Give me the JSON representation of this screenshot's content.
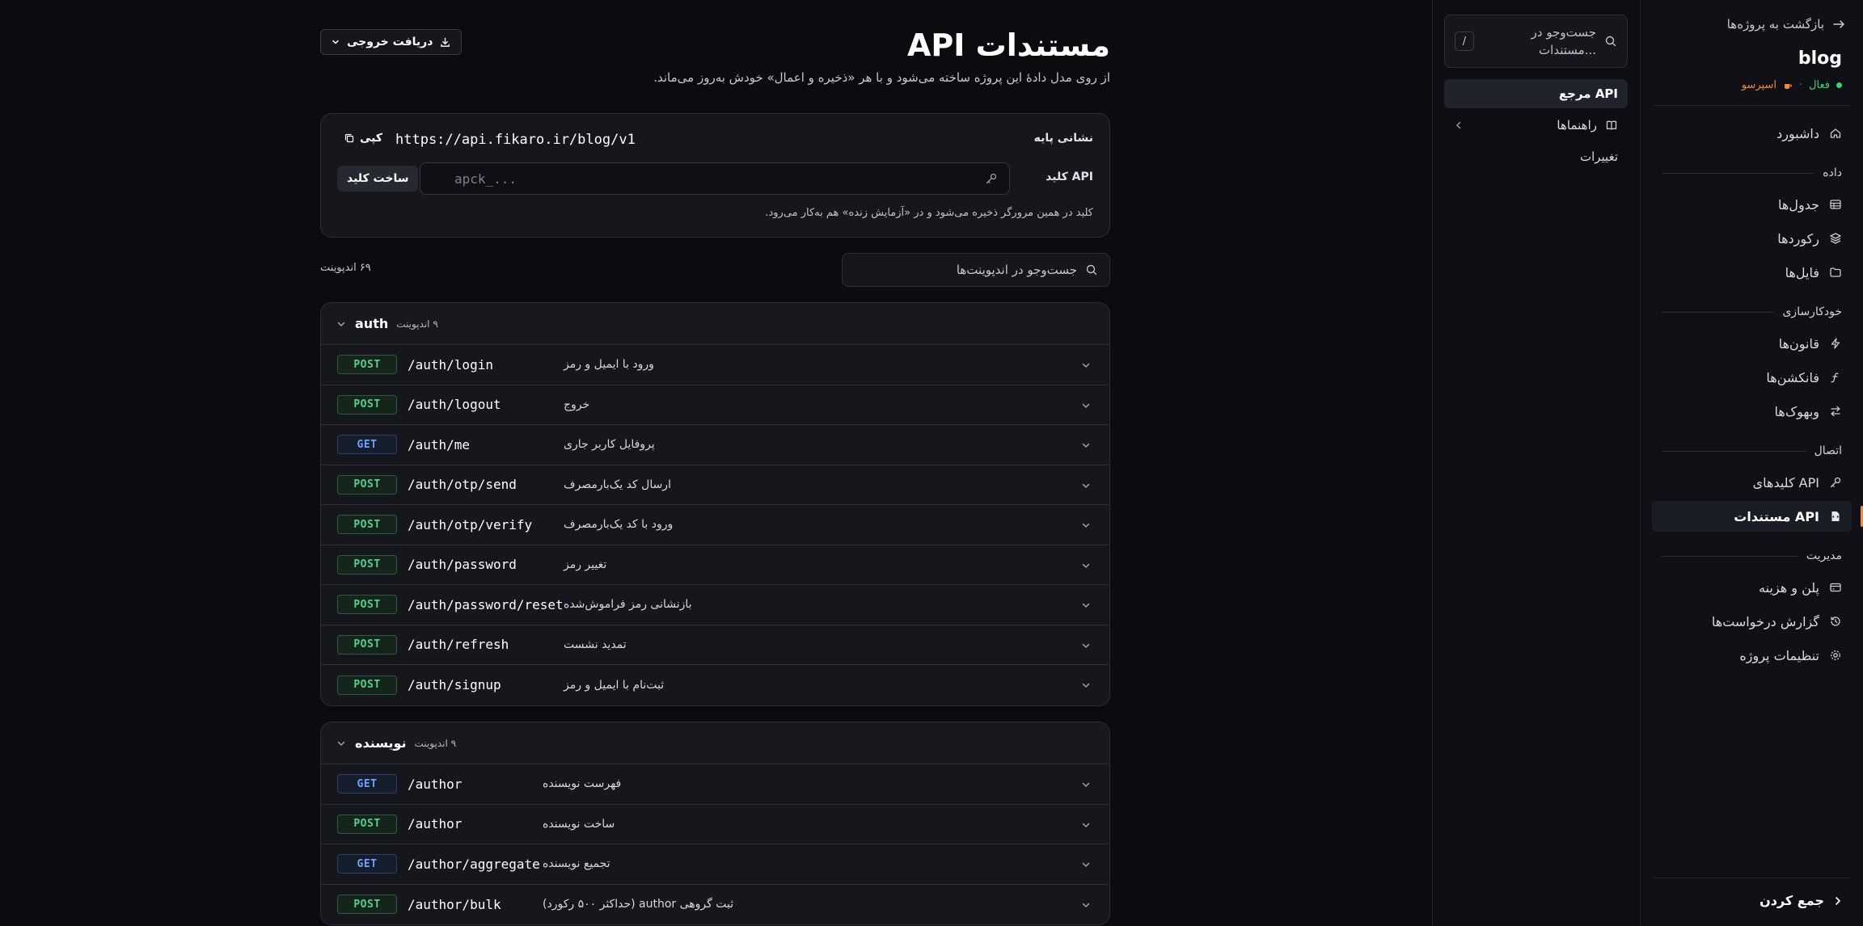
{
  "sidebar": {
    "back_label": "بازگشت به پروژه‌ها",
    "project_name": "blog",
    "status_active": "فعال",
    "status_sep": "·",
    "plan": "اسپرسو",
    "items_top": [
      {
        "label": "داشبورد",
        "icon": "home-icon"
      }
    ],
    "sections": [
      {
        "title": "داده",
        "items": [
          {
            "label": "جدول‌ها",
            "icon": "table-icon"
          },
          {
            "label": "رکوردها",
            "icon": "layers-icon"
          },
          {
            "label": "فایل‌ها",
            "icon": "folder-icon"
          }
        ]
      },
      {
        "title": "خودکارسازی",
        "items": [
          {
            "label": "قانون‌ها",
            "icon": "bolt-icon"
          },
          {
            "label": "فانکشن‌ها",
            "icon": "function-icon"
          },
          {
            "label": "وبهوک‌ها",
            "icon": "swap-icon"
          }
        ]
      },
      {
        "title": "اتصال",
        "items": [
          {
            "label": "کلیدهای API",
            "icon": "key-icon"
          },
          {
            "label": "مستندات API",
            "icon": "doc-icon",
            "active": true
          }
        ]
      },
      {
        "title": "مدیریت",
        "items": [
          {
            "label": "پلن و هزینه",
            "icon": "card-icon"
          },
          {
            "label": "گزارش درخواست‌ها",
            "icon": "history-icon"
          },
          {
            "label": "تنظیمات پروژه",
            "icon": "gear-icon"
          }
        ]
      }
    ],
    "collapse_label": "جمع کردن"
  },
  "docnav": {
    "search_placeholder": "جست‌وجو در مستندات...",
    "search_kbd": "/",
    "items": [
      {
        "label": "مرجع API",
        "active": true
      },
      {
        "label": "راهنماها",
        "icon": "book-icon",
        "expandable": true
      },
      {
        "label": "تغییرات"
      }
    ]
  },
  "main": {
    "title": "مستندات API",
    "subtitle": "از روی مدل دادهٔ این پروژه ساخته می‌شود و با هر «ذخیره و اعمال» خودش به‌روز می‌ماند.",
    "export_label": "دریافت خروجی",
    "base": {
      "base_url_label": "نشانی پایه",
      "base_url": "https://api.fikaro.ir/blog/v1",
      "copy_label": "کپی",
      "api_key_label": "کلید API",
      "api_key_placeholder": "apck_...",
      "generate_label": "ساخت کلید",
      "note": "کلید در همین مرورگر ذخیره می‌شود و در «آزمایش زنده» هم به‌کار می‌رود."
    },
    "endpoint_count": "۶۹ اندپوینت",
    "endpoint_search_placeholder": "جست‌وجو در اندپوینت‌ها",
    "groups": [
      {
        "name": "auth",
        "count": "۹ اندپوینت",
        "endpoints": [
          {
            "method": "POST",
            "path": "/auth/login",
            "desc": "ورود با ایمیل و رمز"
          },
          {
            "method": "POST",
            "path": "/auth/logout",
            "desc": "خروج"
          },
          {
            "method": "GET",
            "path": "/auth/me",
            "desc": "پروفایل کاربر جاری"
          },
          {
            "method": "POST",
            "path": "/auth/otp/send",
            "desc": "ارسال کد یک‌بارمصرف"
          },
          {
            "method": "POST",
            "path": "/auth/otp/verify",
            "desc": "ورود با کد یک‌بارمصرف"
          },
          {
            "method": "POST",
            "path": "/auth/password",
            "desc": "تغییر رمز"
          },
          {
            "method": "POST",
            "path": "/auth/password/reset",
            "desc": "بازنشانی رمز فراموش‌شده"
          },
          {
            "method": "POST",
            "path": "/auth/refresh",
            "desc": "تمدید نشست"
          },
          {
            "method": "POST",
            "path": "/auth/signup",
            "desc": "ثبت‌نام با ایمیل و رمز"
          }
        ]
      },
      {
        "name": "نویسنده",
        "count": "۹ اندپوینت",
        "endpoints": [
          {
            "method": "GET",
            "path": "/author",
            "desc": "فهرست نویسنده"
          },
          {
            "method": "POST",
            "path": "/author",
            "desc": "ساخت نویسنده"
          },
          {
            "method": "GET",
            "path": "/author/aggregate",
            "desc": "تجمیع نویسنده"
          },
          {
            "method": "POST",
            "path": "/author/bulk",
            "desc": "ثبت گروهی author (حداکثر ۵۰۰ رکورد)"
          }
        ]
      }
    ]
  },
  "colors": {
    "accent": "#f08a3c",
    "post": "#56d18a",
    "get": "#6aa5ff",
    "active_status": "#3ecf6e"
  }
}
